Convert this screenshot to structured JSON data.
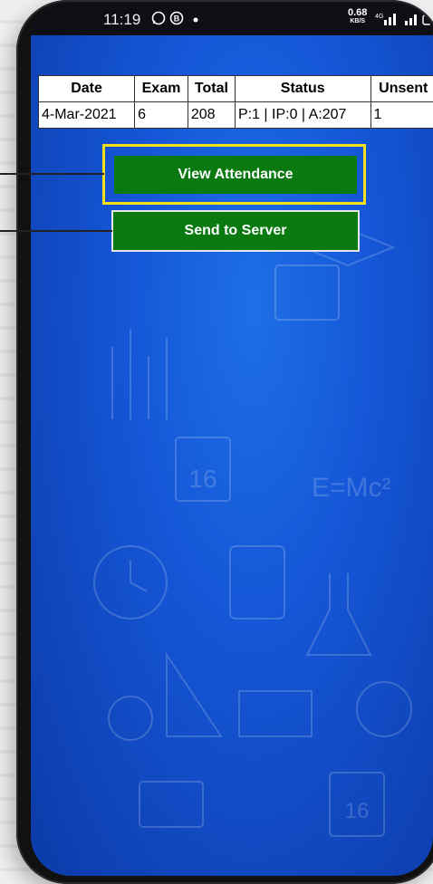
{
  "statusbar": {
    "time": "11:19",
    "net_speed_value": "0.68",
    "net_speed_unit": "KB/S"
  },
  "attendance_table": {
    "headers": [
      "Date",
      "Exam",
      "Total",
      "Status",
      "Unsent"
    ],
    "rows": [
      [
        "4-Mar-2021",
        "6",
        "208",
        "P:1 | IP:0 | A:207",
        "1"
      ]
    ]
  },
  "buttons": {
    "view_attendance": "View Attendance",
    "send_to_server": "Send to Server"
  },
  "colors": {
    "button_green": "#0a7a10",
    "highlight_yellow": "#f7e21a",
    "background_blue": "#1556d6"
  }
}
